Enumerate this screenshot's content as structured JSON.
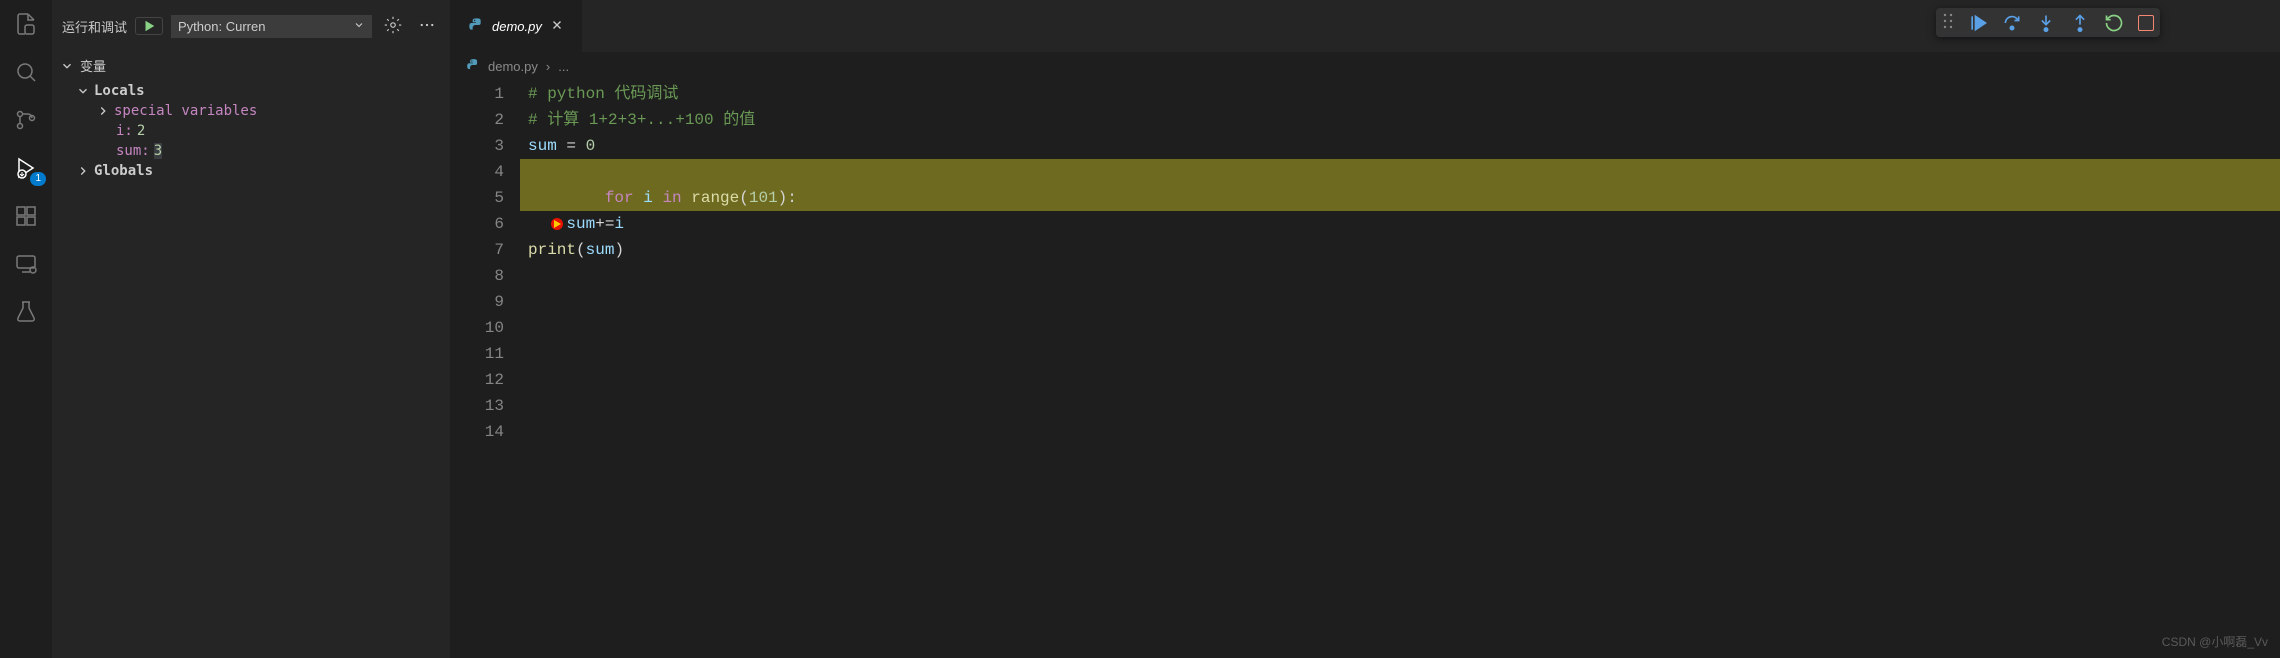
{
  "sidebar": {
    "title": "运行和调试",
    "config_label": "Python: Curren",
    "section_variables": "变量",
    "locals_label": "Locals",
    "special_vars": "special variables",
    "var_i_name": "i:",
    "var_i_value": " 2",
    "var_sum_name": "sum:",
    "var_sum_value": " 3",
    "globals_label": "Globals"
  },
  "debug_badge": "1",
  "tab": {
    "filename": "demo.py"
  },
  "breadcrumb": {
    "file": "demo.py",
    "sep": "›",
    "tail": "..."
  },
  "code": {
    "lines": [
      "1",
      "2",
      "3",
      "4",
      "5",
      "6",
      "7",
      "8",
      "9",
      "10",
      "11",
      "12",
      "13",
      "14"
    ],
    "l1_comment": "# python 代码调试",
    "l2_comment": "# 计算 1+2+3+...+100 的值",
    "l4_var": "sum",
    "l4_op": " = ",
    "l4_num": "0",
    "l7_kw1": "for",
    "l7_var": " i ",
    "l7_kw2": "in",
    "l7_func": " range",
    "l7_paren_open": "(",
    "l7_num": "101",
    "l7_paren_close": "):",
    "l9_indent": "    ",
    "l9_var": "sum",
    "l9_op": "+=",
    "l9_var2": "i",
    "l12_func": "print",
    "l12_open": "(",
    "l12_var": "sum",
    "l12_close": ")"
  },
  "watermark": "CSDN @小啊磊_Vv"
}
